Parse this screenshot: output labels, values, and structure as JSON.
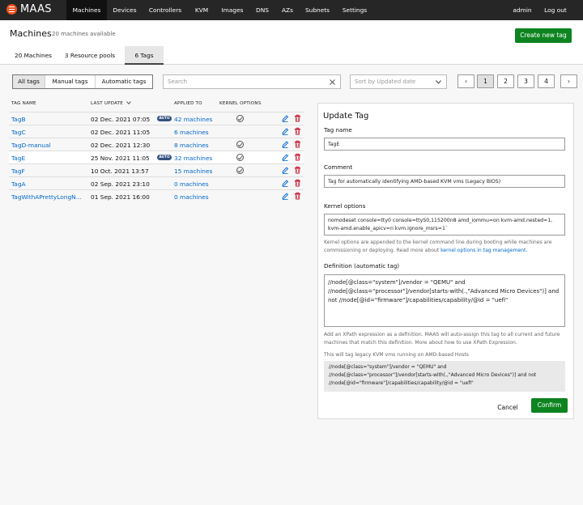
{
  "app": {
    "name": "MAAS"
  },
  "nav": {
    "items": [
      "Machines",
      "Devices",
      "Controllers",
      "KVM",
      "Images",
      "DNS",
      "AZs",
      "Subnets",
      "Settings"
    ],
    "user": "admin",
    "logout": "Log out"
  },
  "header": {
    "title": "Machines",
    "subtitle": "20 machines available",
    "create_tag": "Create new tag"
  },
  "tabs": [
    "20 Machines",
    "3 Resource pools",
    "6 Tags"
  ],
  "filter": {
    "segments": [
      "All tags",
      "Manual tags",
      "Automatic tags"
    ],
    "search_placeholder": "Search",
    "clear_icon": "close-icon",
    "sort_placeholder": "Sort by Updated date"
  },
  "pagination": {
    "prev": "‹",
    "pages": [
      "1",
      "2",
      "3",
      "4"
    ],
    "next": "›",
    "current": "1"
  },
  "table": {
    "headers": {
      "name": "TAG NAME",
      "updated": "LAST UPDATE",
      "applied": "APPLIED TO",
      "kernel": "KERNEL OPTIONS"
    },
    "rows": [
      {
        "name": "TagB",
        "updated": "02 Dec. 2021 07:05",
        "auto": "AUTO",
        "applied": "42 machines",
        "kernel": true
      },
      {
        "name": "TagC",
        "updated": "02 Dec. 2021 11:05",
        "auto": "",
        "applied": "6 machines",
        "kernel": false
      },
      {
        "name": "TagD-manual",
        "updated": "02 Dec. 2021 12:30",
        "auto": "",
        "applied": "8 machines",
        "kernel": true
      },
      {
        "name": "TagE",
        "updated": "25 Nov. 2021 11:05",
        "auto": "AUTO",
        "applied": "32 machines",
        "kernel": true
      },
      {
        "name": "TagF",
        "updated": "10 Oct. 2021 13:57",
        "auto": "",
        "applied": "15 machines",
        "kernel": true
      },
      {
        "name": "TagA",
        "updated": "02 Sep. 2021 23:10",
        "auto": "",
        "applied": "0 machines",
        "kernel": false
      },
      {
        "name": "TagWithAPrettyLongN...",
        "updated": "01 Sep. 2021 16:00",
        "auto": "",
        "applied": "0 machines",
        "kernel": false
      }
    ]
  },
  "form": {
    "title": "Update Tag",
    "tag_name_label": "Tag name",
    "tag_name_value": "TagE",
    "comment_label": "Comment",
    "comment_value": "Tag for automatically identifying AMD-based KVM vms (Legacy BIOS)",
    "kernel_label": "Kernel options",
    "kernel_line1": "nomodeset console=tty0 console=ttyS0,115200n8 amd_iommu=on  kvm-amd.nested=1,",
    "kernel_line2": "kvm-amd.enable_apicv=n  kvm.ignore_msrs=1`",
    "kernel_help": "Kernel options are appended to the kernel command line during booting while machines are commissioning or deploying. Read more about",
    "kernel_help_link": "kernel options in tag management.",
    "definition_label": "Definition (automatic tag)",
    "definition_line1": "//node[@class=\"system\"]/vendor = \"QEMU\" and",
    "definition_line2": "//node[@class=\"processor\"]/vendor[starts-with(.,\"Advanced Micro Devices\")] and",
    "definition_line3": "not //node[@id=\"firmware\"]/capabilities/capability/@id = \"uefi\"",
    "definition_help": "Add an XPath expression as a definition. MAAS will auto-assign this tag to  all current and future machines that match this definition. More about how to use XPath Expression.",
    "preview_note": "This will tag legacy KVM vms running on AMD-based Hosts",
    "preview_line1": "//node[@class=\"system\"]/vendor = \"QEMU\" and",
    "preview_line2": "//node[@class=\"processor\"]/vendor[starts-with(.,\"Advanced Micro Devices\")] and not",
    "preview_line3": "//node[@id=\"firmware\"]/capabilities/capability/@id = \"uefi\"",
    "cancel": "Cancel",
    "confirm": "Confirm"
  },
  "colors": {
    "accent": "#0e8420",
    "link": "#0066cc",
    "nav_bg": "#262626",
    "danger": "#c7162b"
  }
}
